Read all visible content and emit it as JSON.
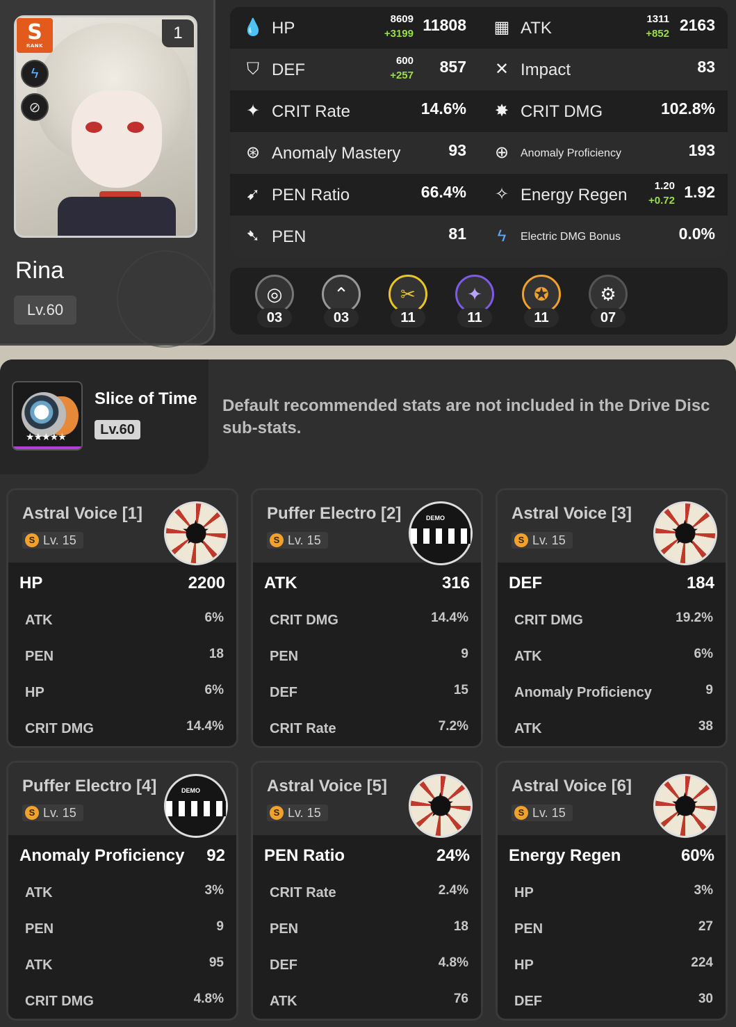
{
  "character": {
    "name": "Rina",
    "level": "Lv.60",
    "rank": "S",
    "rank_sub": "RANK",
    "mindscape": "1",
    "attribute_icon": "electric-icon",
    "type_icon": "anomaly-icon"
  },
  "stats": {
    "left": [
      {
        "label": "HP",
        "icon": "hp-icon",
        "base": "8609",
        "bonus": "+3199",
        "value": "11808"
      },
      {
        "label": "DEF",
        "icon": "def-icon",
        "base": "600",
        "bonus": "+257",
        "value": "857"
      },
      {
        "label": "CRIT Rate",
        "icon": "crit-rate-icon",
        "value": "14.6%"
      },
      {
        "label": "Anomaly Mastery",
        "icon": "anomaly-mastery-icon",
        "value": "93"
      },
      {
        "label": "PEN Ratio",
        "icon": "pen-ratio-icon",
        "value": "66.4%"
      },
      {
        "label": "PEN",
        "icon": "pen-icon",
        "value": "81"
      }
    ],
    "right": [
      {
        "label": "ATK",
        "icon": "atk-icon",
        "base": "1311",
        "bonus": "+852",
        "value": "2163"
      },
      {
        "label": "Impact",
        "icon": "impact-icon",
        "value": "83"
      },
      {
        "label": "CRIT DMG",
        "icon": "crit-dmg-icon",
        "value": "102.8%"
      },
      {
        "label": "Anomaly Proficiency",
        "icon": "anomaly-proficiency-icon",
        "value": "193"
      },
      {
        "label": "Energy Regen",
        "icon": "energy-regen-icon",
        "base": "1.20",
        "bonus": "+0.72",
        "value": "1.92"
      },
      {
        "label": "Electric DMG Bonus",
        "icon": "electric-dmg-icon",
        "value": "0.0%"
      }
    ]
  },
  "set_counts": [
    {
      "icon": "set-icon-1",
      "count": "03"
    },
    {
      "icon": "set-icon-2",
      "count": "03"
    },
    {
      "icon": "set-icon-3",
      "count": "11"
    },
    {
      "icon": "set-icon-4",
      "count": "11"
    },
    {
      "icon": "set-icon-5",
      "count": "11"
    },
    {
      "icon": "set-icon-6",
      "count": "07"
    }
  ],
  "wengine": {
    "name": "Slice of Time",
    "level": "Lv.60"
  },
  "notice": "Default recommended stats are not included in the Drive Disc sub-stats.",
  "discs": [
    {
      "name": "Astral Voice [1]",
      "level": "Lv. 15",
      "art": "astral",
      "main_stat": "HP",
      "main_value": "2200",
      "subs": [
        {
          "label": "ATK",
          "value": "6%"
        },
        {
          "label": "PEN",
          "value": "18"
        },
        {
          "label": "HP",
          "value": "6%"
        },
        {
          "label": "CRIT DMG",
          "value": "14.4%"
        }
      ]
    },
    {
      "name": "Puffer Electro [2]",
      "level": "Lv. 15",
      "art": "puffer",
      "main_stat": "ATK",
      "main_value": "316",
      "subs": [
        {
          "label": "CRIT DMG",
          "value": "14.4%"
        },
        {
          "label": "PEN",
          "value": "9"
        },
        {
          "label": "DEF",
          "value": "15"
        },
        {
          "label": "CRIT Rate",
          "value": "7.2%"
        }
      ]
    },
    {
      "name": "Astral Voice [3]",
      "level": "Lv. 15",
      "art": "astral",
      "main_stat": "DEF",
      "main_value": "184",
      "subs": [
        {
          "label": "CRIT DMG",
          "value": "19.2%"
        },
        {
          "label": "ATK",
          "value": "6%"
        },
        {
          "label": "Anomaly Proficiency",
          "value": "9"
        },
        {
          "label": "ATK",
          "value": "38"
        }
      ]
    },
    {
      "name": "Puffer Electro [4]",
      "level": "Lv. 15",
      "art": "puffer",
      "main_stat": "Anomaly Proficiency",
      "main_value": "92",
      "subs": [
        {
          "label": "ATK",
          "value": "3%"
        },
        {
          "label": "PEN",
          "value": "9"
        },
        {
          "label": "ATK",
          "value": "95"
        },
        {
          "label": "CRIT DMG",
          "value": "4.8%"
        }
      ]
    },
    {
      "name": "Astral Voice [5]",
      "level": "Lv. 15",
      "art": "astral",
      "main_stat": "PEN Ratio",
      "main_value": "24%",
      "subs": [
        {
          "label": "CRIT Rate",
          "value": "2.4%"
        },
        {
          "label": "PEN",
          "value": "18"
        },
        {
          "label": "DEF",
          "value": "4.8%"
        },
        {
          "label": "ATK",
          "value": "76"
        }
      ]
    },
    {
      "name": "Astral Voice [6]",
      "level": "Lv. 15",
      "art": "astral",
      "main_stat": "Energy Regen",
      "main_value": "60%",
      "subs": [
        {
          "label": "HP",
          "value": "3%"
        },
        {
          "label": "PEN",
          "value": "27"
        },
        {
          "label": "HP",
          "value": "224"
        },
        {
          "label": "DEF",
          "value": "30"
        }
      ]
    }
  ],
  "colors": {
    "bonus_green": "#9adf47",
    "rank_orange": "#e35b1c",
    "level_badge": "#f0a22c"
  }
}
